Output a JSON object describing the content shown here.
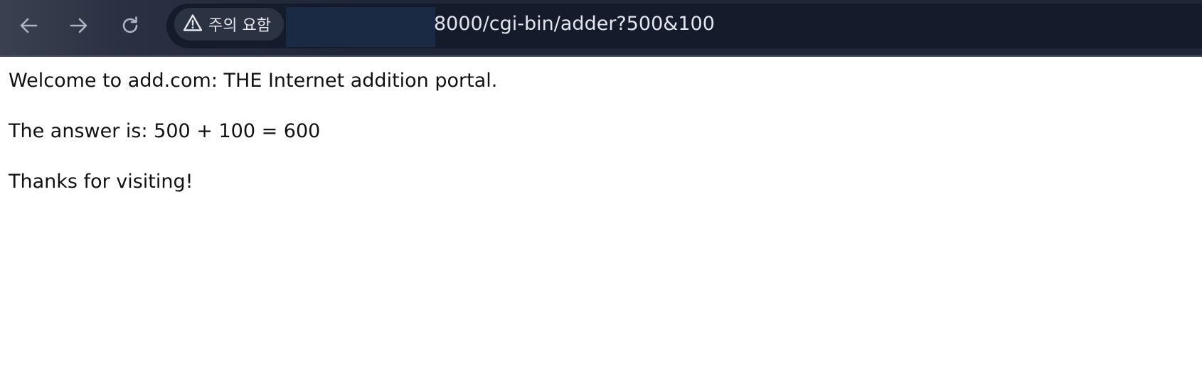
{
  "browser": {
    "security_chip": {
      "icon": "warning-triangle-icon",
      "label": "주의 요함"
    },
    "url_visible": "8000/cgi-bin/adder?500&100"
  },
  "page": {
    "welcome_line": "Welcome to add.com: THE Internet addition portal.",
    "answer_line": "The answer is: 500 + 100 = 600",
    "thanks_line": "Thanks for visiting!"
  }
}
